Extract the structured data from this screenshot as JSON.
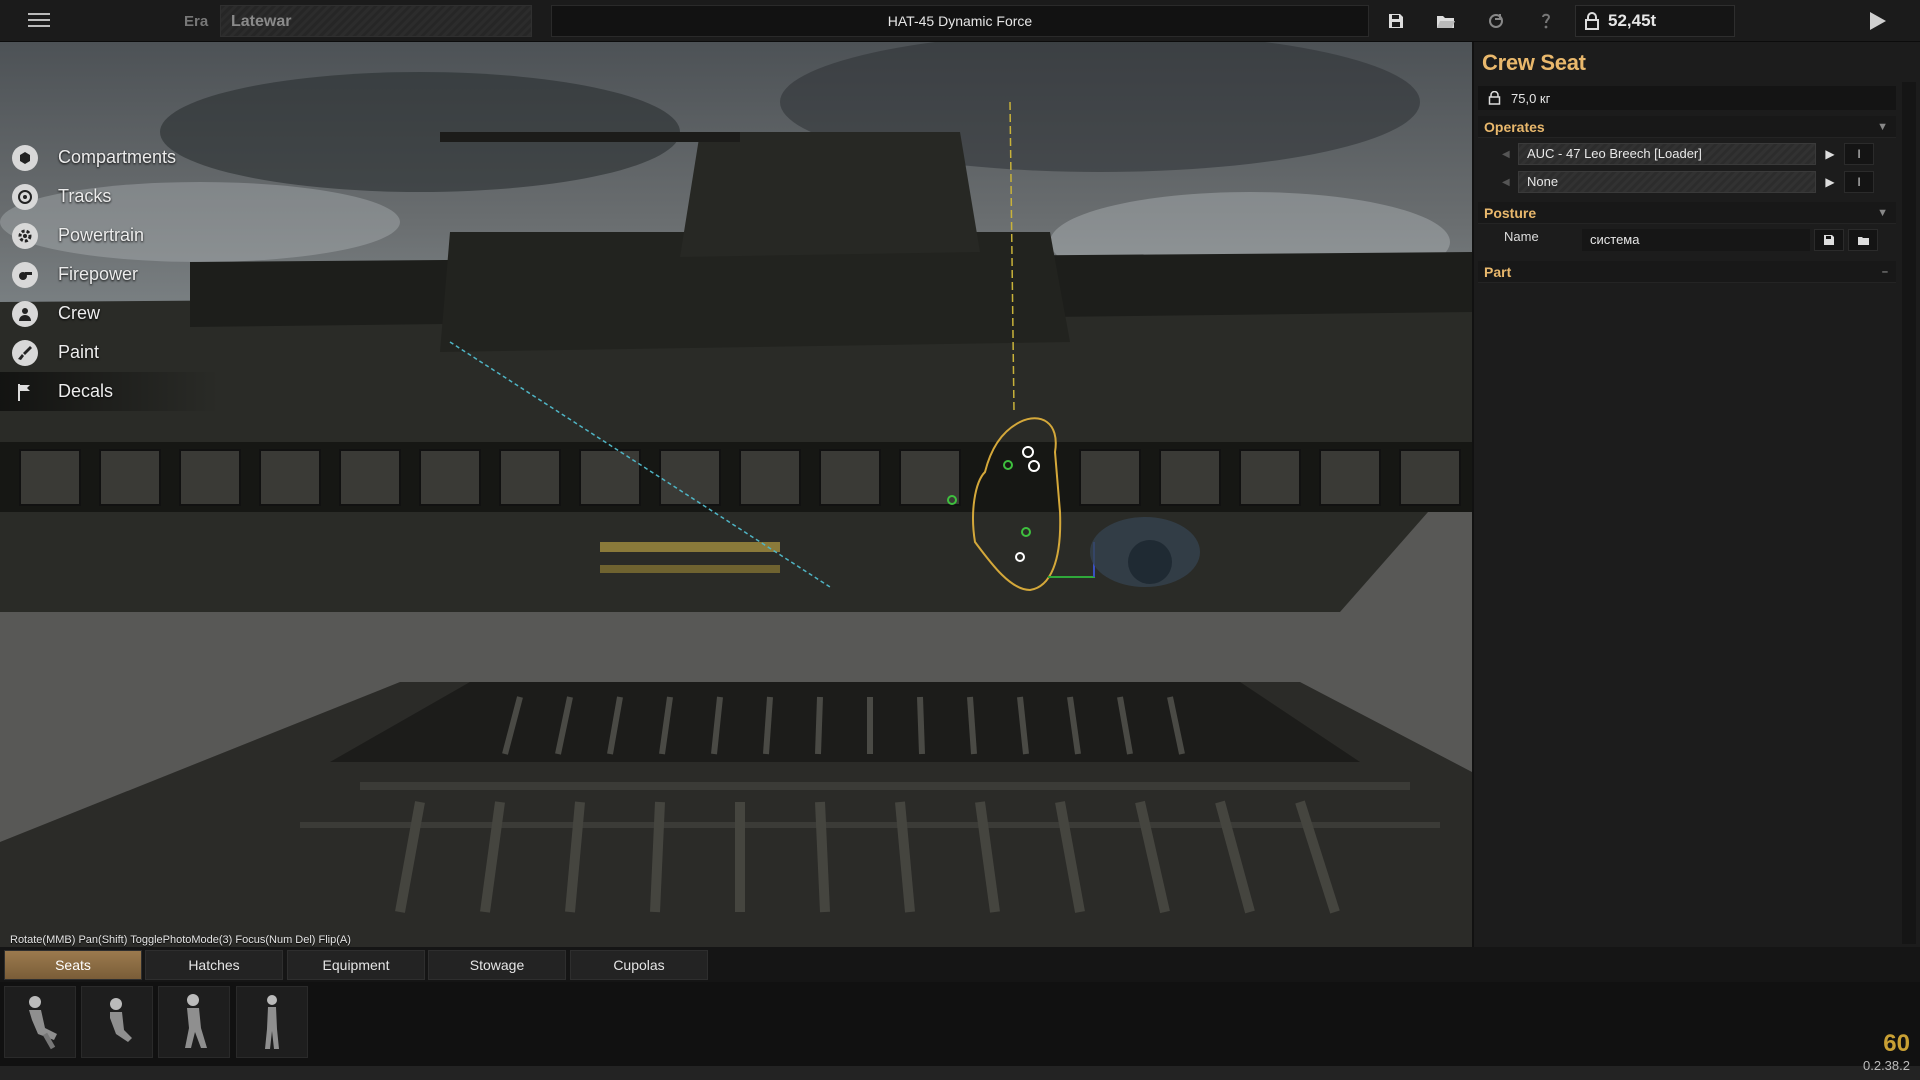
{
  "topbar": {
    "era_label": "Era",
    "era_value": "Latewar",
    "vehicle_title": "HAT-45 Dynamic Force",
    "weight": "52,45t",
    "icons": [
      "menu-icon",
      "save-icon",
      "open-folder-icon",
      "reset-icon",
      "hint-icon",
      "weight-lock-icon",
      "play-icon"
    ]
  },
  "side_menu": {
    "items": [
      {
        "label": "Compartments",
        "icon": "box-icon"
      },
      {
        "label": "Tracks",
        "icon": "track-icon"
      },
      {
        "label": "Powertrain",
        "icon": "gear-icon"
      },
      {
        "label": "Firepower",
        "icon": "cannon-icon"
      },
      {
        "label": "Crew",
        "icon": "person-icon"
      },
      {
        "label": "Paint",
        "icon": "brush-icon"
      },
      {
        "label": "Decals",
        "icon": "flag-icon"
      }
    ],
    "active": "Decals"
  },
  "viewport": {
    "controls_hint": "Rotate(MMB) Pan(Shift) TogglePhotoMode(3) Focus(Num Del) Flip(A)"
  },
  "panel": {
    "title": "Crew Seat",
    "weight": "75,0 кг",
    "operates_header": "Operates",
    "operates": [
      {
        "value": "AUC - 47 Leo Breech [Loader]",
        "button": "I"
      },
      {
        "value": "None",
        "button": "I"
      }
    ],
    "posture_header": "Posture",
    "name_label": "Name",
    "name_value": "система",
    "part_header": "Part"
  },
  "tabs": {
    "items": [
      "Seats",
      "Hatches",
      "Equipment",
      "Stowage",
      "Cupolas"
    ],
    "active": "Seats"
  },
  "parts": {
    "count_shown": 4
  },
  "status": {
    "fps": "60",
    "version": "0.2.38.2"
  },
  "colors": {
    "accent": "#e9b86c",
    "active_tab": "#9b7a4e",
    "fps": "#c9a034"
  }
}
